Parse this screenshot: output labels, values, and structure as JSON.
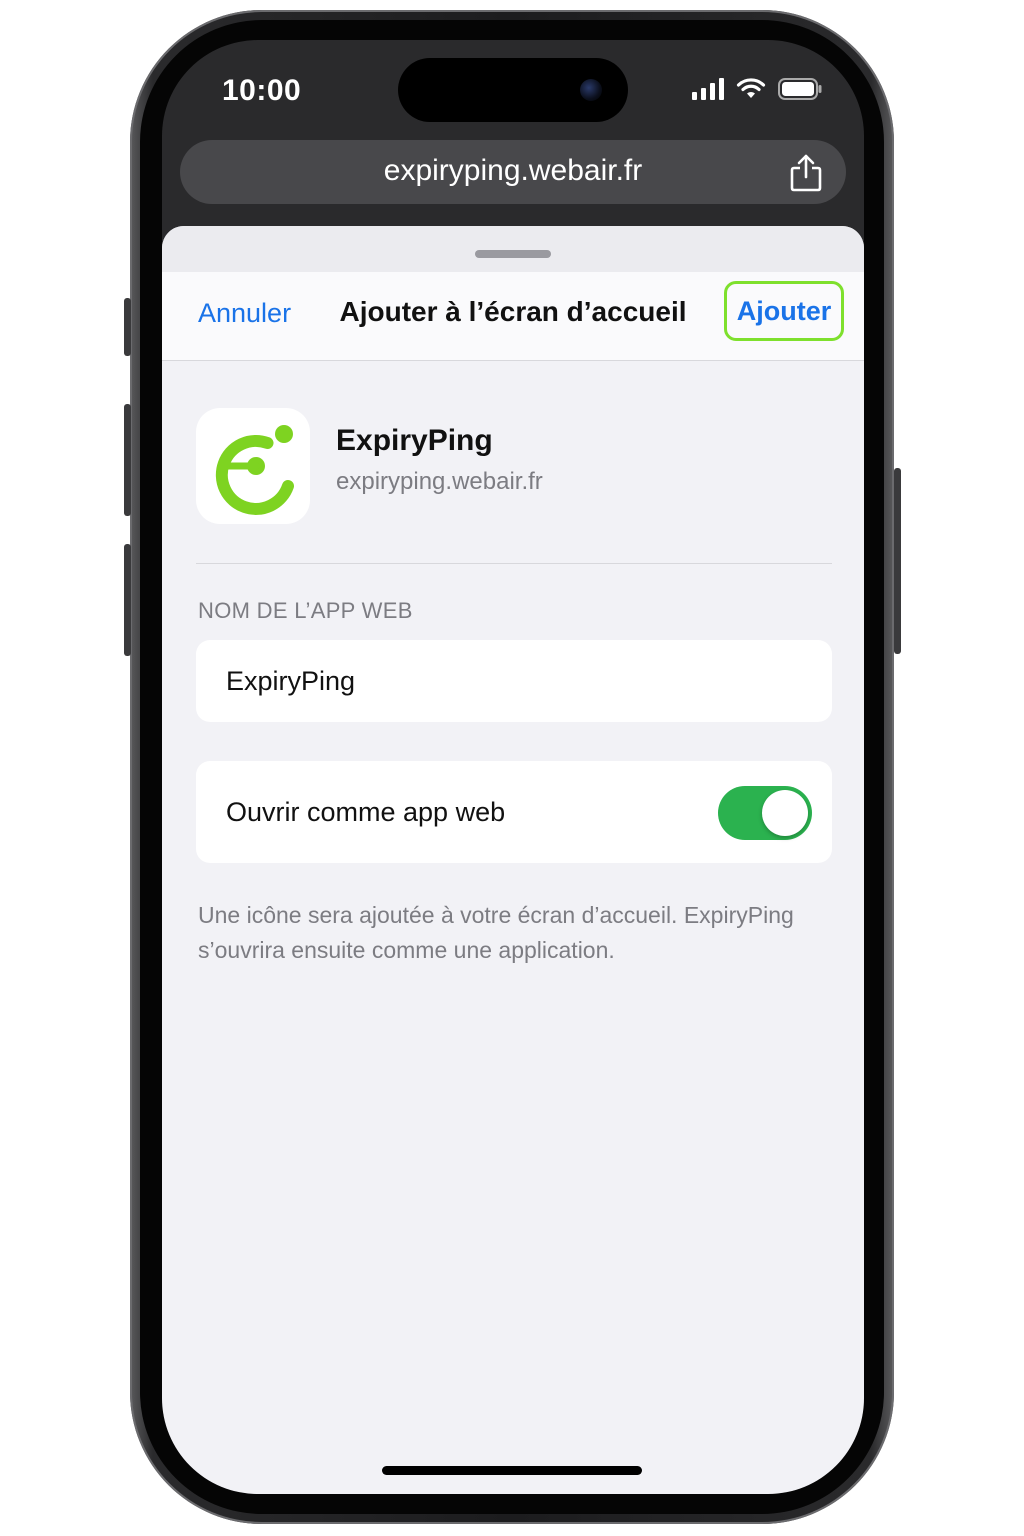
{
  "status_bar": {
    "time": "10:00",
    "icons": [
      "cellular-signal-icon",
      "wifi-icon",
      "battery-icon"
    ]
  },
  "browser": {
    "url": "expiryping.webair.fr",
    "share_icon": "share-icon"
  },
  "sheet": {
    "cancel_label": "Annuler",
    "title": "Ajouter à l’écran d’accueil",
    "add_label": "Ajouter",
    "app": {
      "name": "ExpiryPing",
      "url": "expiryping.webair.fr",
      "icon": "expiryping-logo-icon"
    },
    "section_label": "NOM DE L’APP WEB",
    "name_field_value": "ExpiryPing",
    "toggle_label": "Ouvrir comme app web",
    "toggle_on": true,
    "footnote": "Une icône sera ajoutée à votre écran d’accueil. ExpiryPing s’ouvrira ensuite comme une application."
  },
  "colors": {
    "accent_blue": "#1a73e8",
    "toggle_green": "#2bb24f",
    "highlight_green": "#7ee02d",
    "logo_green": "#7ed321"
  }
}
